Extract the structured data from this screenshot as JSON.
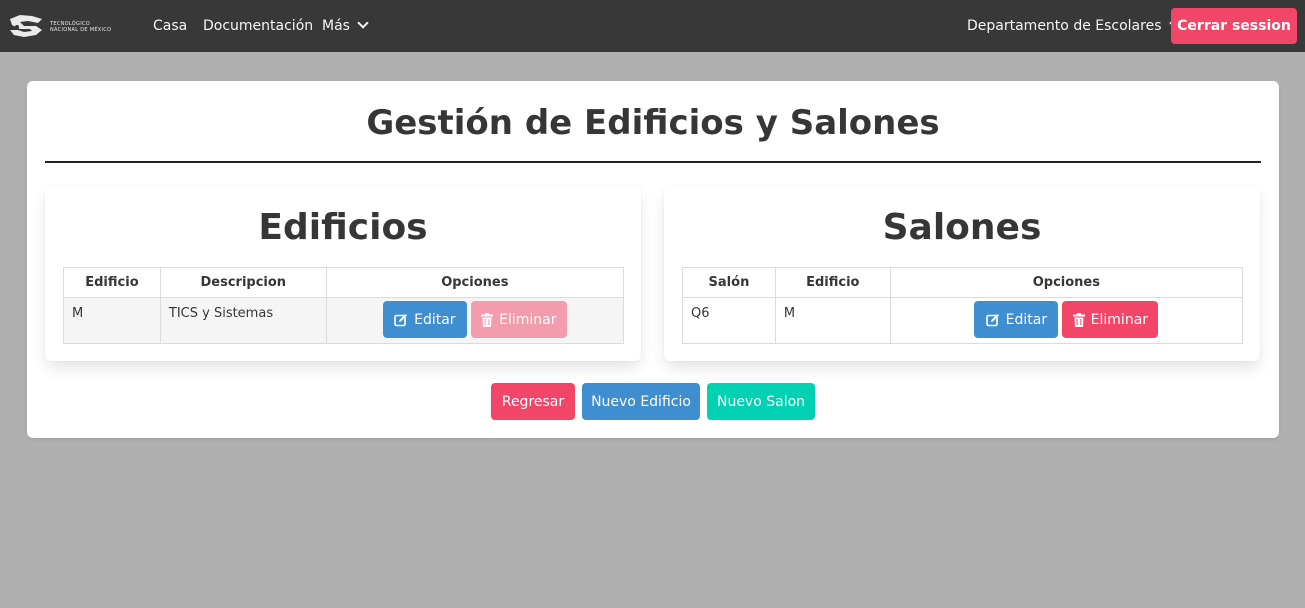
{
  "navbar": {
    "brand_line1": "TECNOLÓGICO",
    "brand_line2": "NACIONAL DE MÉXICO",
    "links": [
      "Casa",
      "Documentación",
      "Más"
    ],
    "department": "Departamento de Escolares",
    "logout_label": "Cerrar session"
  },
  "page": {
    "title": "Gestión de Edificios y Salones"
  },
  "edificios": {
    "title": "Edificios",
    "headers": [
      "Edificio",
      "Descripcion",
      "Opciones"
    ],
    "rows": [
      {
        "edificio": "M",
        "descripcion": "TICS y Sistemas",
        "edit_label": "Editar",
        "delete_label": "Eliminar",
        "delete_disabled": true
      }
    ]
  },
  "salones": {
    "title": "Salones",
    "headers": [
      "Salón",
      "Edificio",
      "Opciones"
    ],
    "rows": [
      {
        "salon": "Q6",
        "edificio": "M",
        "edit_label": "Editar",
        "delete_label": "Eliminar",
        "delete_disabled": false
      }
    ]
  },
  "actions": {
    "back_label": "Regresar",
    "new_building_label": "Nuevo Edificio",
    "new_room_label": "Nuevo Salon"
  },
  "colors": {
    "navbar_bg": "#383838",
    "danger": "#f14668",
    "info": "#3e8ed0",
    "primary": "#00d1b2",
    "page_bg": "#b0b0b0"
  },
  "icons": {
    "edit": "edit-icon",
    "delete": "trash-icon",
    "dropdown": "chevron-down-icon",
    "logo": "tecnm-logo"
  }
}
